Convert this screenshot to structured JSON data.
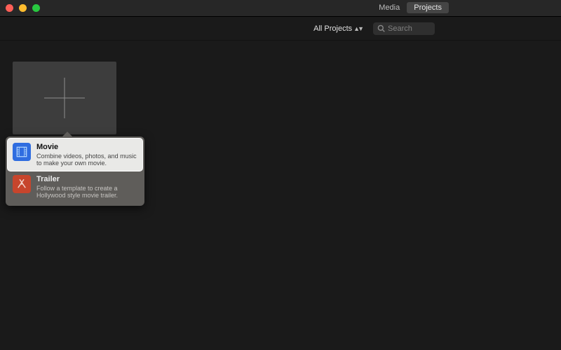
{
  "titlebar": {
    "tabs": {
      "media": "Media",
      "projects": "Projects"
    }
  },
  "toolbar": {
    "filter_label": "All Projects",
    "search_placeholder": "Search"
  },
  "popover": {
    "movie": {
      "title": "Movie",
      "subtitle": "Combine videos, photos, and music to make your own movie."
    },
    "trailer": {
      "title": "Trailer",
      "subtitle": "Follow a template to create a Hollywood style movie trailer."
    }
  }
}
